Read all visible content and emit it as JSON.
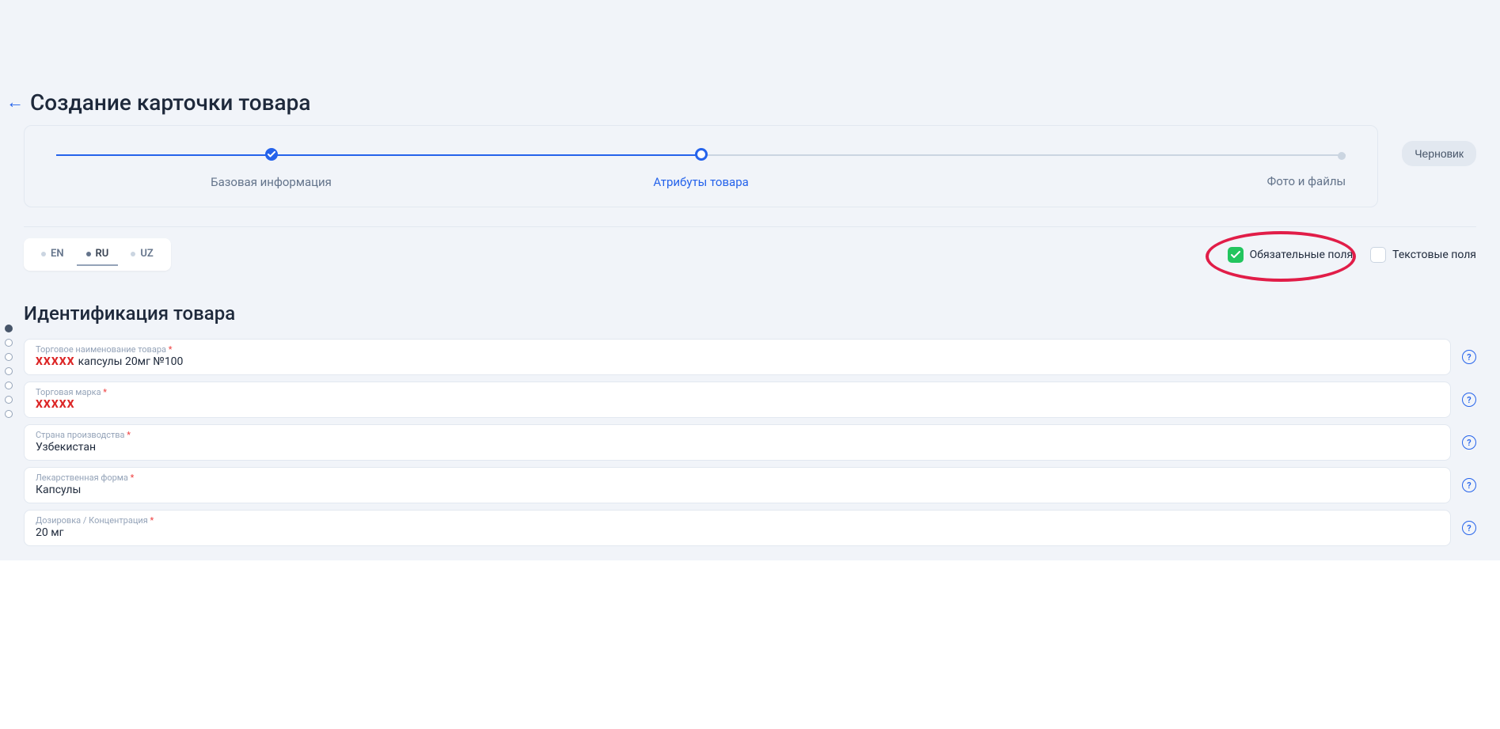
{
  "header": {
    "title": "Создание карточки товара"
  },
  "stepper": {
    "step1": "Базовая информация",
    "step2": "Атрибуты товара",
    "step3": "Фото и файлы"
  },
  "actions": {
    "draft": "Черновик"
  },
  "langs": {
    "en": "EN",
    "ru": "RU",
    "uz": "UZ"
  },
  "filters": {
    "required": "Обязательные поля",
    "text": "Текстовые поля"
  },
  "section": {
    "title": "Идентификация товара"
  },
  "fields": {
    "tradeName": {
      "label": "Торговое наименование товара",
      "redacted": "XXXXX",
      "suffix": " капсулы 20мг №100"
    },
    "tradeMark": {
      "label": "Торговая марка",
      "redacted": "XXXXX",
      "suffix": ""
    },
    "country": {
      "label": "Страна производства",
      "value": "Узбекистан"
    },
    "form": {
      "label": "Лекарственная форма",
      "value": "Капсулы"
    },
    "dosage": {
      "label": "Дозировка / Концентрация",
      "value": "20 мг"
    }
  },
  "colors": {
    "accent": "#2563eb",
    "success": "#22c55e",
    "danger": "#e11d48"
  }
}
